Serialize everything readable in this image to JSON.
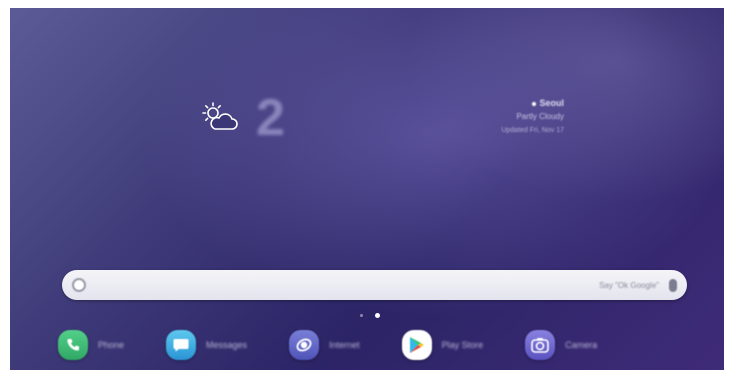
{
  "weather": {
    "icon": "partly-cloudy-icon",
    "temperature": "2"
  },
  "location": {
    "city": "Seoul",
    "subtitle": "Partly Cloudy",
    "date": "Updated Fri, Nov 17"
  },
  "search": {
    "logo": "google-logo-icon",
    "placeholder": "Say \"Ok Google\"",
    "mic": "microphone-icon"
  },
  "page_indicator": {
    "pages": 2,
    "active_page": 2
  },
  "dock": {
    "items": [
      {
        "label": "Phone",
        "icon": "phone-icon",
        "color": "#3cbd74"
      },
      {
        "label": "Messages",
        "icon": "messages-icon",
        "color": "#3aa9e0"
      },
      {
        "label": "Internet",
        "icon": "internet-icon",
        "color": "#6267c8"
      },
      {
        "label": "Play Store",
        "icon": "play-store-icon",
        "color": "#ffffff"
      },
      {
        "label": "Camera",
        "icon": "camera-icon",
        "color": "#6d66d0"
      }
    ]
  }
}
